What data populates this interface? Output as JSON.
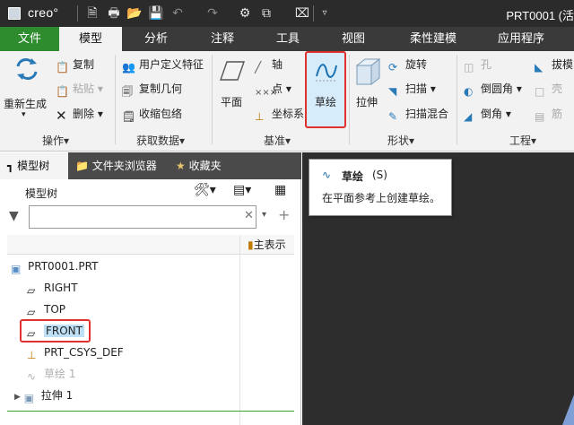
{
  "app": {
    "logo_text": "creo°",
    "window_title": "PRT0001 (活"
  },
  "tabs": [
    {
      "label": "文件"
    },
    {
      "label": "模型"
    },
    {
      "label": "分析"
    },
    {
      "label": "注释"
    },
    {
      "label": "工具"
    },
    {
      "label": "视图"
    },
    {
      "label": "柔性建模"
    },
    {
      "label": "应用程序"
    }
  ],
  "ribbon": {
    "operations": {
      "regenerate": "重新生成",
      "copy": "复制",
      "paste": "粘贴",
      "delete": "删除",
      "group_label": "操作"
    },
    "get_data": {
      "udf": "用户定义特征",
      "copy_geom": "复制几何",
      "shrinkwrap": "收缩包络",
      "group_label": "获取数据"
    },
    "datum": {
      "plane": "平面",
      "axis": "轴",
      "point": "点",
      "csys": "坐标系",
      "sketch": "草绘",
      "group_label": "基准"
    },
    "shapes": {
      "extrude": "拉伸",
      "revolve": "旋转",
      "sweep": "扫描",
      "swept_blend": "扫描混合",
      "group_label": "形状"
    },
    "engineering": {
      "hole": "孔",
      "round": "倒圆角",
      "chamfer": "倒角",
      "draft": "拔模",
      "shell": "壳",
      "rib": "筋",
      "group_label": "工程"
    }
  },
  "panel": {
    "tabs": [
      {
        "label": "模型树"
      },
      {
        "label": "文件夹浏览器"
      },
      {
        "label": "收藏夹"
      }
    ],
    "header": "模型树",
    "filter_value": "",
    "column_header": "主表示",
    "tree": [
      {
        "label": "PRT0001.PRT"
      },
      {
        "label": "RIGHT"
      },
      {
        "label": "TOP"
      },
      {
        "label": "FRONT"
      },
      {
        "label": "PRT_CSYS_DEF"
      },
      {
        "label": "草绘 1"
      },
      {
        "label": "拉伸 1"
      }
    ]
  },
  "tooltip": {
    "title": "草绘",
    "shortcut": "(S)",
    "description": "在平面参考上创建草绘。"
  },
  "colors": {
    "file_tab": "#2e8b2e",
    "highlight_border": "#e03030",
    "selection": "#bfe0f6"
  }
}
